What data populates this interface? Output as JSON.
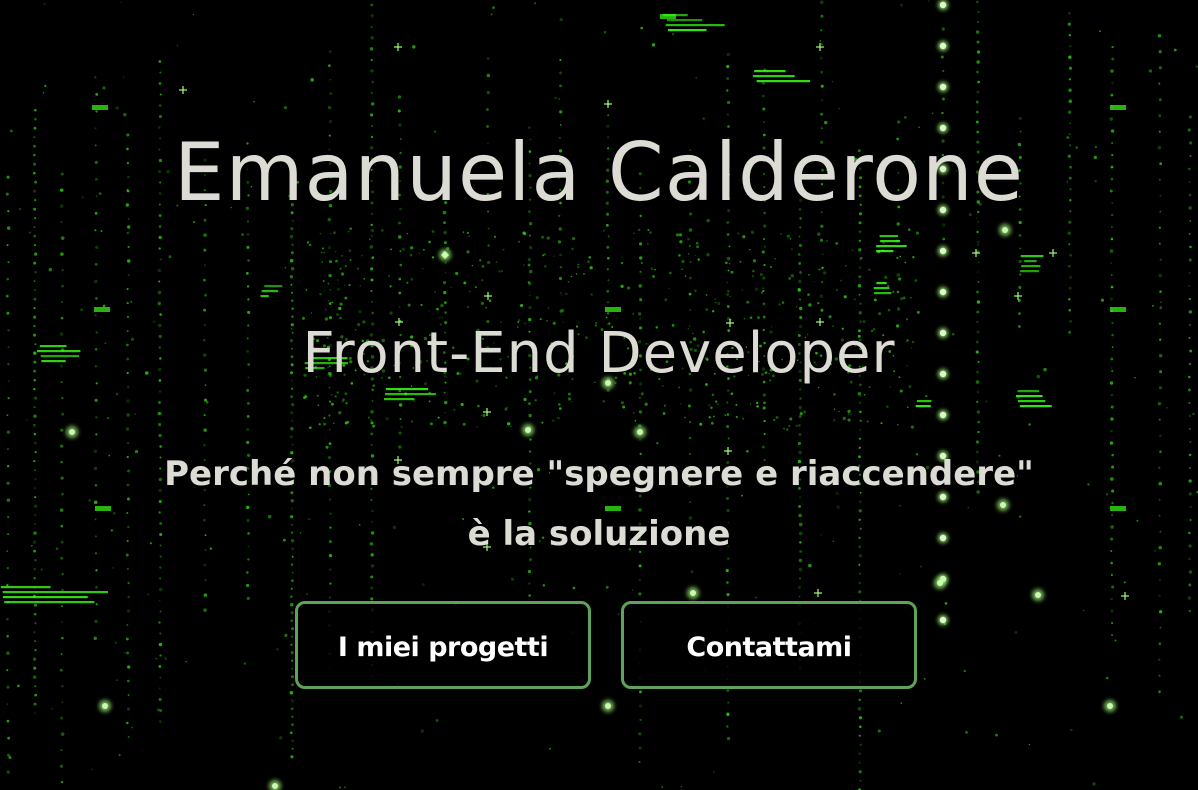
{
  "hero": {
    "name": "Emanuela Calderone",
    "role": "Front-End Developer",
    "tagline": "Perché non sempre \"spegnere e riaccendere\" è la soluzione",
    "buttons": {
      "projects_label": "I miei progetti",
      "contact_label": "Contattami"
    }
  },
  "background": {
    "icon": "matrix-code-rain",
    "color_primary": "#39ff14",
    "color_bright": "#a6ff7a",
    "color_text": "#dcdcd4",
    "button_border": "#5fa35a"
  }
}
